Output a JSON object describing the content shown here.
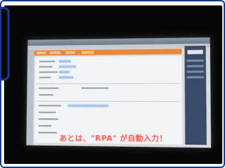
{
  "subtitle": "あとは、\"RPA\" が自動入力！",
  "colors": {
    "frame_border": "#1b3a8f",
    "video_background": "#070707",
    "subtitle_text": "#ff5a5a",
    "screen_nav_bar": "#e9873a",
    "screen_form_field": "#a9c6e6"
  }
}
